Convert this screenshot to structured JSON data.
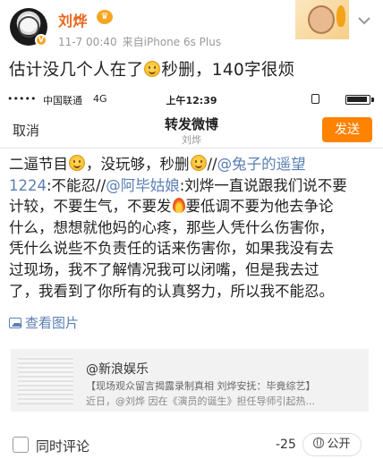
{
  "post": {
    "username": "刘烨",
    "timestamp": "11-7 00:40",
    "source": "来自iPhone 6s Plus",
    "text_before": "估计没几个人在了",
    "text_after": "秒删，140字很烦"
  },
  "phone": {
    "status": {
      "signal": "•••••",
      "carrier": "中国联通",
      "network": "4G",
      "time": "上午12:39"
    },
    "nav": {
      "cancel": "取消",
      "title": "转发微博",
      "subtitle": "刘烨",
      "send": "发送"
    },
    "body": {
      "l1a": "二逼节目",
      "l1b": "，没玩够，秒删",
      "l1c": "//",
      "l1d": "@兔子的遥望",
      "l2a": "1224",
      "l2b": ":不能忍//",
      "l2c": "@阿毕姑娘",
      "l2d": ":刘烨一直说跟我们说不要",
      "l3a": "计较，不要生气，不要发",
      "l3b": "要低调不要为他去争论",
      "l4": "什么，想想就他妈的心疼，那些人凭什么伤害你，",
      "l5": "凭什么说些不负责任的话来伤害你，如果我没有去",
      "l6": "过现场，我不了解情况我可以闭嘴，但是我去过",
      "l7": "了，我看到了你所有的认真努力，所以我不能忍。",
      "images_link": "查看图片"
    },
    "quote": {
      "author": "@新浪娱乐",
      "title": "【现场观众留言揭露录制真相 刘烨安抚：毕竟综艺】",
      "snippet": "近日，@刘烨 因在《演员的诞生》担任导师引起热..."
    },
    "footer": {
      "checkbox_label": "同时评论",
      "counter": "-25",
      "visibility": "公开"
    }
  }
}
